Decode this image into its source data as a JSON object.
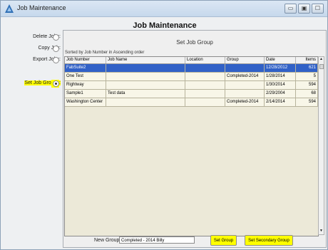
{
  "window": {
    "title": "Job Maintenance",
    "controls": {
      "minimize": "▭",
      "restore": "▣",
      "close": "☐"
    }
  },
  "page": {
    "heading": "Job Maintenance"
  },
  "options": [
    {
      "label": "Delete Jobs:",
      "selected": false
    },
    {
      "label": "Copy Job:",
      "selected": false
    },
    {
      "label": "Export Jobs:",
      "selected": false
    },
    {
      "label": "Set Job Groups:",
      "selected": true
    }
  ],
  "panel": {
    "title": "Set Job Group",
    "sort_text": "Sorted by Job Number in Ascending order",
    "columns": [
      "Job Number",
      "Job Name",
      "Location",
      "Group",
      "Date",
      "Items"
    ],
    "rows": [
      [
        "FabSuite2",
        "",
        "",
        "",
        "12/28/2012",
        "621"
      ],
      [
        "One Test",
        "",
        "",
        "Completed-2014",
        "1/28/2014",
        "5"
      ],
      [
        "Rightway",
        "",
        "",
        "",
        "1/30/2014",
        "594"
      ],
      [
        "Sample1",
        "Test data",
        "",
        "",
        "2/29/2004",
        "68"
      ],
      [
        "Washington Center",
        "",
        "",
        "Completed-2014",
        "2/14/2014",
        "594"
      ]
    ],
    "selected_row": 0,
    "scroll": {
      "up": "▲",
      "down": "▼"
    }
  },
  "bottom": {
    "new_group_label": "New Group:",
    "new_group_value": "Completed - 2014  Billy",
    "set_group_btn": "Set Group",
    "set_secondary_btn": "Set Secondary Group"
  },
  "colors": {
    "highlight": "#ffff00",
    "selection": "#3161c7",
    "table_bg": "#ece9d8"
  }
}
